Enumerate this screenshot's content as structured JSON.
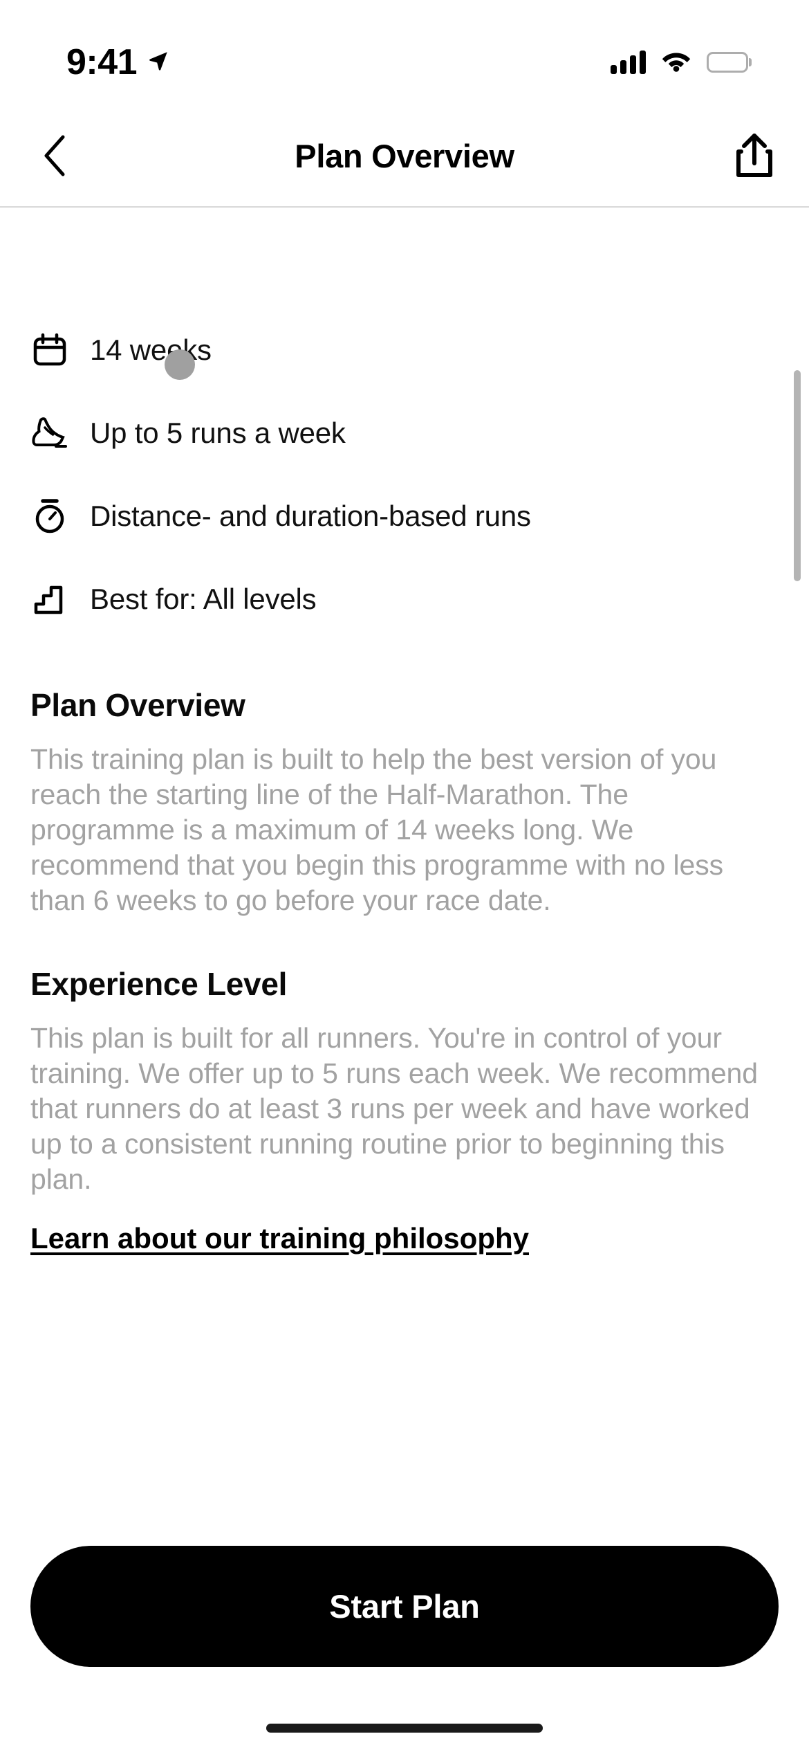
{
  "status_bar": {
    "time": "9:41",
    "location_icon": "location-arrow-icon",
    "cellular_icon": "cellular-bars-icon",
    "wifi_icon": "wifi-icon",
    "battery_icon": "battery-full-icon"
  },
  "nav": {
    "back_icon": "chevron-left-icon",
    "title": "Plan Overview",
    "share_icon": "share-icon"
  },
  "features": [
    {
      "icon": "calendar-icon",
      "label": "14 weeks"
    },
    {
      "icon": "running-shoe-icon",
      "label": "Up to 5 runs a week"
    },
    {
      "icon": "stopwatch-icon",
      "label": "Distance- and duration-based runs"
    },
    {
      "icon": "stairs-icon",
      "label": "Best for: All levels"
    }
  ],
  "sections": [
    {
      "heading": "Plan Overview",
      "body": "This training plan is built to help the best version of you reach the starting line of the Half-Marathon. The programme is a maximum of 14 weeks long. We recommend that you begin this programme with no less than 6 weeks to go before your race date."
    },
    {
      "heading": "Experience Level",
      "body": "This plan is built for all runners. You're in control of your training. We offer up to 5 runs each week. We recommend that runners do at least 3 runs per week and have worked up to a consistent running routine prior to beginning this plan."
    }
  ],
  "philosophy_link": "Learn about our training philosophy",
  "cta": {
    "label": "Start Plan"
  },
  "colors": {
    "background": "#ffffff",
    "primary_text": "#000000",
    "secondary_text": "#a2a2a2",
    "cta_background": "#000000",
    "cta_text": "#ffffff",
    "divider": "#d9d9d9",
    "scrollbar": "#b4b4b4",
    "cursor": "#a0a0a0"
  }
}
